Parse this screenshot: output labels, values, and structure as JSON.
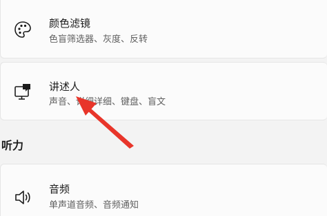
{
  "settings": {
    "color_filters": {
      "title": "颜色滤镜",
      "subtitle": "色盲筛选器、灰度、反转",
      "icon": "palette-icon"
    },
    "narrator": {
      "title": "讲述人",
      "subtitle": "声音、详细详细、键盘、盲文",
      "icon": "narrator-icon"
    },
    "hearing_section": {
      "heading": "听力"
    },
    "audio": {
      "title": "音频",
      "subtitle": "单声道音频、音频通知",
      "icon": "speaker-icon"
    }
  },
  "annotation": {
    "arrow_color": "#e8352a"
  }
}
